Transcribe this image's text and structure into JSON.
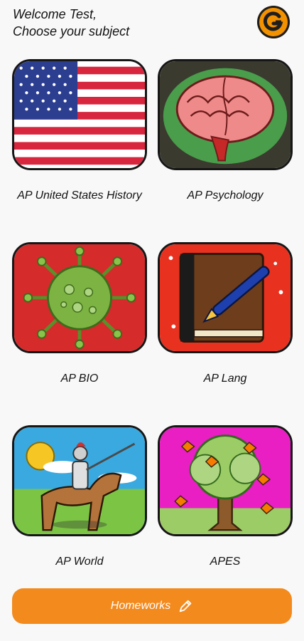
{
  "header": {
    "welcome_line": "Welcome Test,",
    "subtitle_line": "Choose your subject",
    "logo_icon": "g-logo-icon"
  },
  "subjects": [
    {
      "label": "AP United States History",
      "icon": "american-flag-icon"
    },
    {
      "label": "AP Psychology",
      "icon": "brain-icon"
    },
    {
      "label": "AP BIO",
      "icon": "virus-icon"
    },
    {
      "label": "AP Lang",
      "icon": "book-and-pen-icon"
    },
    {
      "label": "AP World",
      "icon": "knight-on-horse-icon"
    },
    {
      "label": "APES",
      "icon": "tree-with-butterflies-icon"
    }
  ],
  "footer": {
    "homeworks_label": "Homeworks",
    "homeworks_icon": "pencil-icon"
  },
  "colors": {
    "accent": "#f28a1e",
    "logo_bg": "#f39200"
  }
}
